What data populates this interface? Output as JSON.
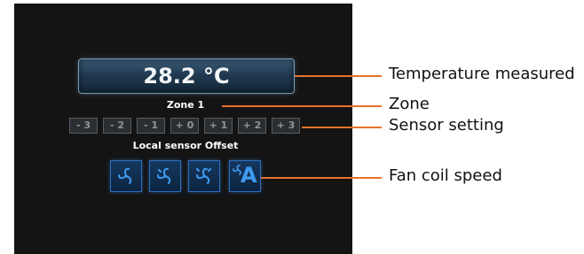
{
  "display": {
    "temperature": "28.2 °C",
    "zone": "Zone 1",
    "offset_label": "Local sensor Offset",
    "offset_buttons": [
      "- 3",
      "- 2",
      "- 1",
      "+ 0",
      "+ 1",
      "+ 2",
      "+ 3"
    ],
    "fan_buttons": [
      {
        "icon": "fan-speed-1-icon"
      },
      {
        "icon": "fan-speed-2-icon"
      },
      {
        "icon": "fan-speed-3-icon"
      },
      {
        "icon": "fan-auto-icon",
        "letter": "A"
      }
    ]
  },
  "callouts": {
    "temperature": "Temperature measured",
    "zone": "Zone",
    "sensor": "Sensor setting",
    "fan": "Fan coil speed"
  },
  "colors": {
    "screen_bg": "#141414",
    "callout_line": "#e9712a",
    "fan_accent": "#3f9bf0"
  }
}
